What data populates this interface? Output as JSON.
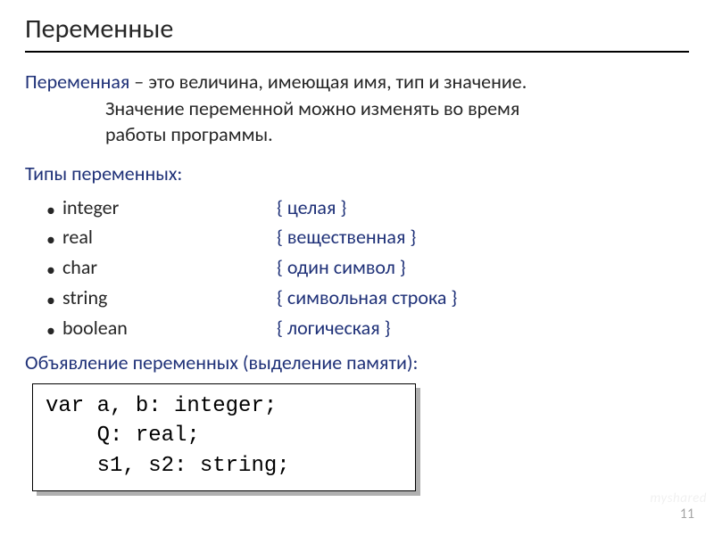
{
  "title": "Переменные",
  "definition": {
    "term": "Переменная",
    "line1_rest": " – это величина, имеющая имя, тип и значение.",
    "line2": "Значение переменной можно изменять во время",
    "line3": "работы программы."
  },
  "types_heading": "Типы переменных:",
  "types": [
    {
      "name": "integer",
      "desc": "{ целая }"
    },
    {
      "name": "real",
      "desc": "{ вещественная }"
    },
    {
      "name": "char",
      "desc": "{ один символ }"
    },
    {
      "name": "string",
      "desc": "{ символьная строка }"
    },
    {
      "name": "boolean",
      "desc": "{ логическая }"
    }
  ],
  "decl_heading": "Объявление переменных (выделение памяти):",
  "code": {
    "line1": "var a, b: integer;",
    "line2": "    Q: real;",
    "line3": "    s1, s2: string;"
  },
  "page_number": "11",
  "watermark": "myshared"
}
